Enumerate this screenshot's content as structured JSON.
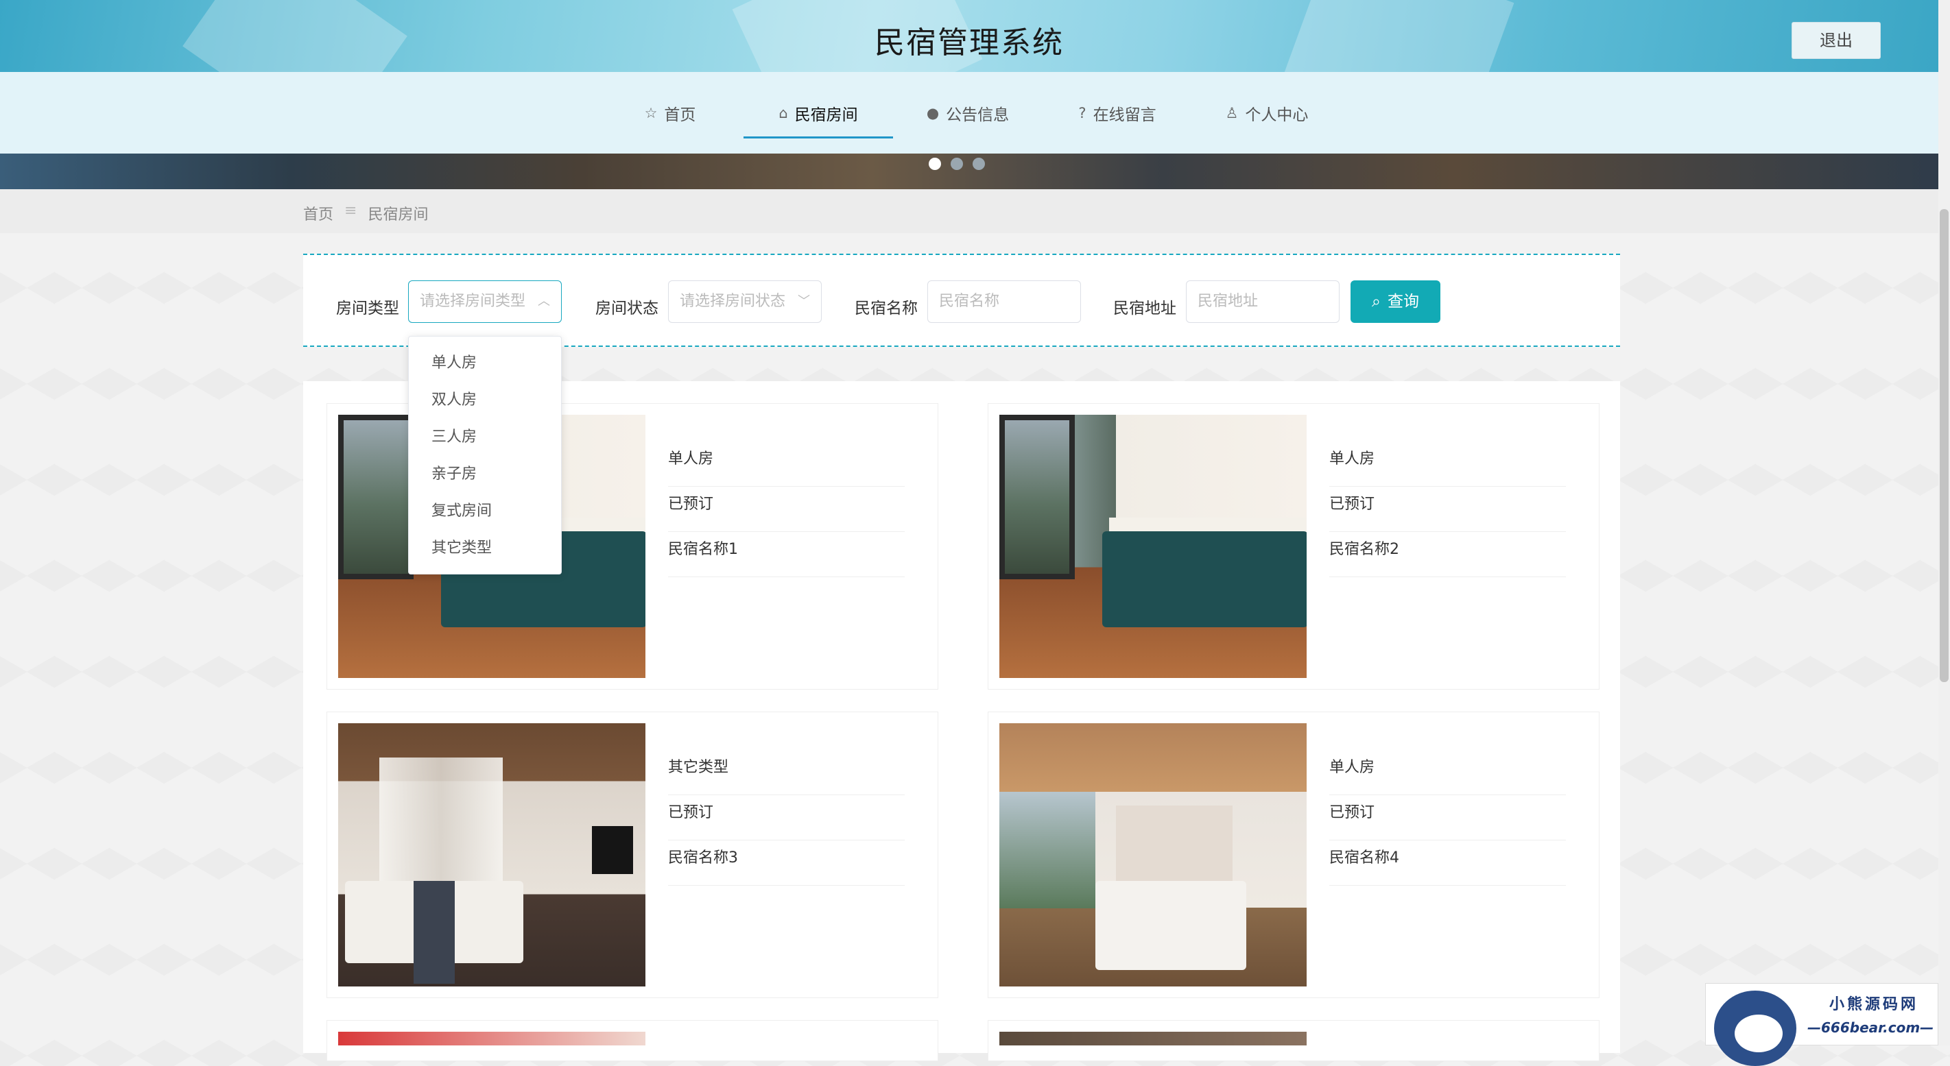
{
  "header": {
    "title": "民宿管理系统",
    "logout_label": "退出"
  },
  "nav": {
    "items": [
      {
        "label": "首页",
        "icon": "star-icon"
      },
      {
        "label": "民宿房间",
        "icon": "bag-icon"
      },
      {
        "label": "公告信息",
        "icon": "info-icon"
      },
      {
        "label": "在线留言",
        "icon": "question-icon"
      },
      {
        "label": "个人中心",
        "icon": "user-icon"
      }
    ],
    "active": "民宿房间"
  },
  "breadcrumb": {
    "home": "首页",
    "separator": "≡",
    "current": "民宿房间"
  },
  "search": {
    "room_type_label": "房间类型",
    "room_type_placeholder": "请选择房间类型",
    "room_status_label": "房间状态",
    "room_status_placeholder": "请选择房间状态",
    "name_label": "民宿名称",
    "name_placeholder": "民宿名称",
    "address_label": "民宿地址",
    "address_placeholder": "民宿地址",
    "query_label": "查询",
    "accent_color": "#12aab5"
  },
  "dropdown": {
    "options": [
      "单人房",
      "双人房",
      "三人房",
      "亲子房",
      "复式房间",
      "其它类型"
    ]
  },
  "rooms": [
    {
      "type": "单人房",
      "status": "已预订",
      "name": "民宿名称1"
    },
    {
      "type": "单人房",
      "status": "已预订",
      "name": "民宿名称2"
    },
    {
      "type": "其它类型",
      "status": "已预订",
      "name": "民宿名称3"
    },
    {
      "type": "单人房",
      "status": "已预订",
      "name": "民宿名称4"
    }
  ],
  "watermark": {
    "line1": "小熊源码网",
    "line2": "—666bear.com—"
  }
}
